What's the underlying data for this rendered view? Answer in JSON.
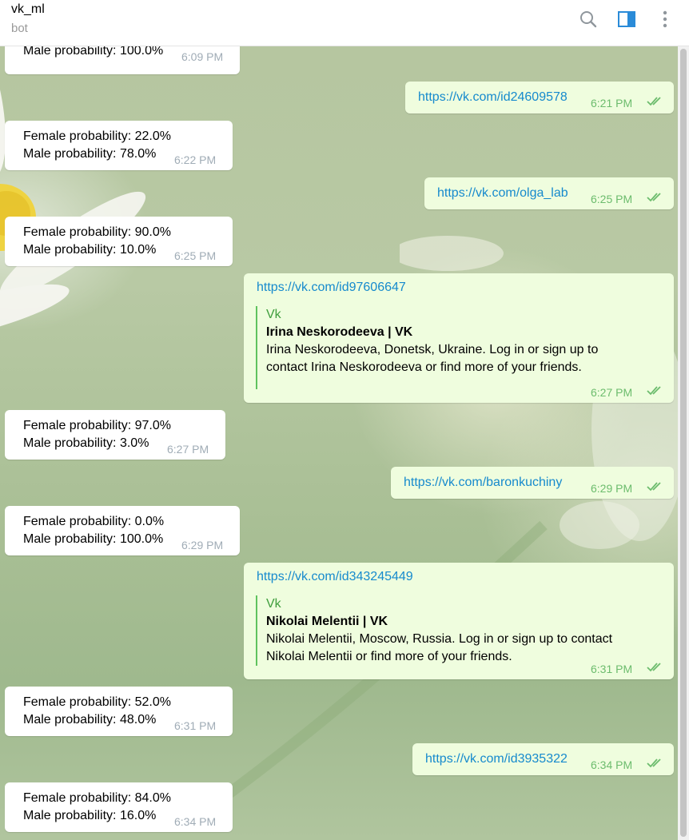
{
  "header": {
    "title": "vk_ml",
    "status": "bot"
  },
  "messages": [
    {
      "dir": "in",
      "lines": [
        "Male probability: 100.0%"
      ],
      "time": "6:09 PM"
    },
    {
      "dir": "out",
      "link": "https://vk.com/id24609578",
      "time": "6:21 PM"
    },
    {
      "dir": "in",
      "lines": [
        "Female probability: 22.0%",
        "Male probability: 78.0%"
      ],
      "time": "6:22 PM"
    },
    {
      "dir": "out",
      "link": "https://vk.com/olga_lab",
      "time": "6:25 PM"
    },
    {
      "dir": "in",
      "lines": [
        "Female probability: 90.0%",
        "Male probability: 10.0%"
      ],
      "time": "6:25 PM"
    },
    {
      "dir": "out",
      "link": "https://vk.com/id97606647",
      "time": "6:27 PM",
      "preview": {
        "site": "Vk",
        "title": "Irina Neskorodeeva | VK",
        "desc1": "Irina Neskorodeeva, Donetsk, Ukraine. Log in or sign up to",
        "desc2": "contact Irina Neskorodeeva or find more of your friends."
      }
    },
    {
      "dir": "in",
      "lines": [
        "Female probability: 97.0%",
        "Male probability: 3.0%"
      ],
      "time": "6:27 PM"
    },
    {
      "dir": "out",
      "link": "https://vk.com/baronkuchiny",
      "time": "6:29 PM"
    },
    {
      "dir": "in",
      "lines": [
        "Female probability: 0.0%",
        "Male probability: 100.0%"
      ],
      "time": "6:29 PM"
    },
    {
      "dir": "out",
      "link": "https://vk.com/id343245449",
      "time": "6:31 PM",
      "preview": {
        "site": "Vk",
        "title": "Nikolai Melentii | VK",
        "desc1": "Nikolai Melentii, Moscow, Russia. Log in or sign up to contact",
        "desc2": "Nikolai Melentii or find more of your friends."
      }
    },
    {
      "dir": "in",
      "lines": [
        "Female probability: 52.0%",
        "Male probability: 48.0%"
      ],
      "time": "6:31 PM"
    },
    {
      "dir": "out",
      "link": "https://vk.com/id3935322",
      "time": "6:34 PM"
    },
    {
      "dir": "in",
      "lines": [
        "Female probability: 84.0%",
        "Male probability: 16.0%"
      ],
      "time": "6:34 PM"
    }
  ],
  "icons": {
    "search": "search-icon",
    "sidebar": "sidebar-toggle-icon",
    "menu": "more-vertical-icon",
    "read": "double-check-icon"
  },
  "colors": {
    "outgoing_bubble": "#effdde",
    "incoming_bubble": "#ffffff",
    "link": "#168acd",
    "read_check": "#6cbc6d",
    "accent": "#2a8bd8"
  }
}
